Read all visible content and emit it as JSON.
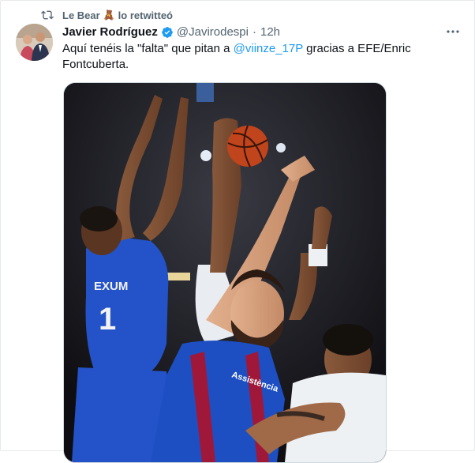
{
  "retweet": {
    "name": "Le Bear",
    "emoji": "🧸",
    "suffix": "lo retwitteó"
  },
  "tweet": {
    "author_name": "Javier Rodríguez",
    "handle": "@Javirodespi",
    "separator": "·",
    "time": "12h",
    "text_part1": "Aquí tenéis la \"falta\" que pitan a ",
    "mention": "@viinze_17P",
    "text_part2": " gracias a EFE/Enric Fontcuberta."
  },
  "photo": {
    "jersey_name": "EXUM",
    "jersey_number": "1",
    "sponsor_text": "Assistència"
  },
  "colors": {
    "accent": "#1d9bf0",
    "secondary_text": "#536471",
    "barca_blue": "#1d4fc2",
    "barca_red": "#a01839"
  }
}
